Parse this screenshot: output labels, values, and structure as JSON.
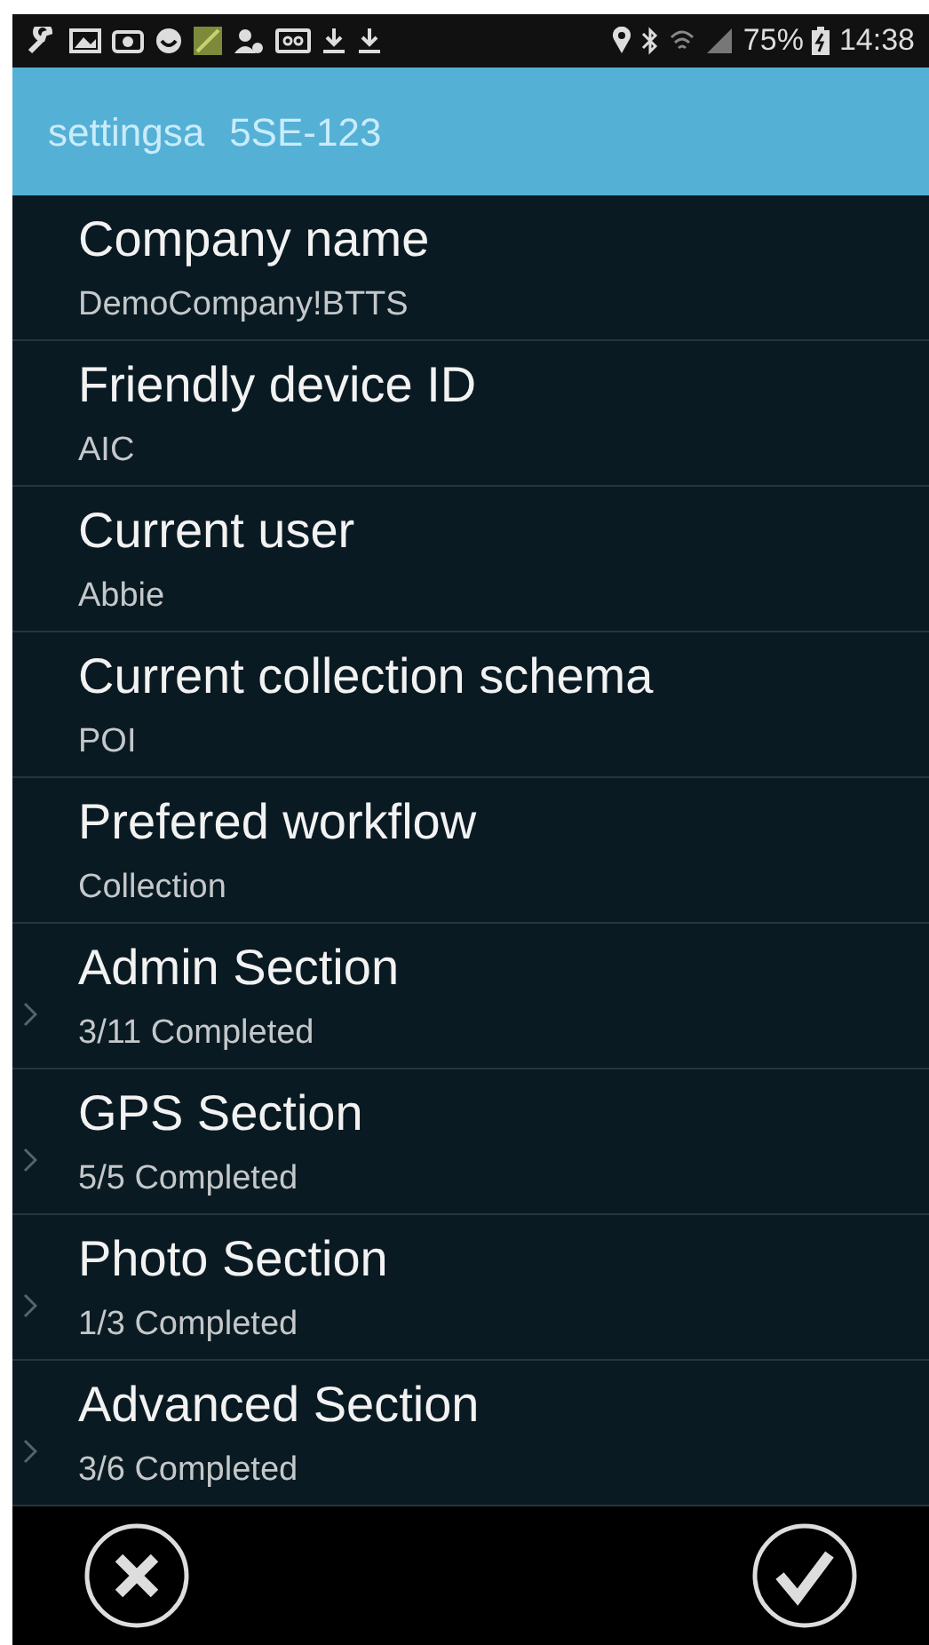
{
  "status_bar": {
    "battery": "75%",
    "time": "14:38"
  },
  "app_bar": {
    "title": "settingsa",
    "subtitle": "5SE-123"
  },
  "settings": [
    {
      "kind": "value",
      "title": "Company name",
      "summary": "DemoCompany!BTTS"
    },
    {
      "kind": "value",
      "title": "Friendly device ID",
      "summary": "AIC"
    },
    {
      "kind": "value",
      "title": "Current user",
      "summary": "Abbie"
    },
    {
      "kind": "value",
      "title": "Current collection schema",
      "summary": "POI"
    },
    {
      "kind": "value",
      "title": "Prefered workflow",
      "summary": "Collection"
    },
    {
      "kind": "section",
      "title": "Admin Section",
      "summary": "3/11 Completed"
    },
    {
      "kind": "section",
      "title": "GPS Section",
      "summary": "5/5 Completed"
    },
    {
      "kind": "section",
      "title": "Photo Section",
      "summary": "1/3 Completed"
    },
    {
      "kind": "section",
      "title": "Advanced Section",
      "summary": "3/6 Completed"
    }
  ]
}
